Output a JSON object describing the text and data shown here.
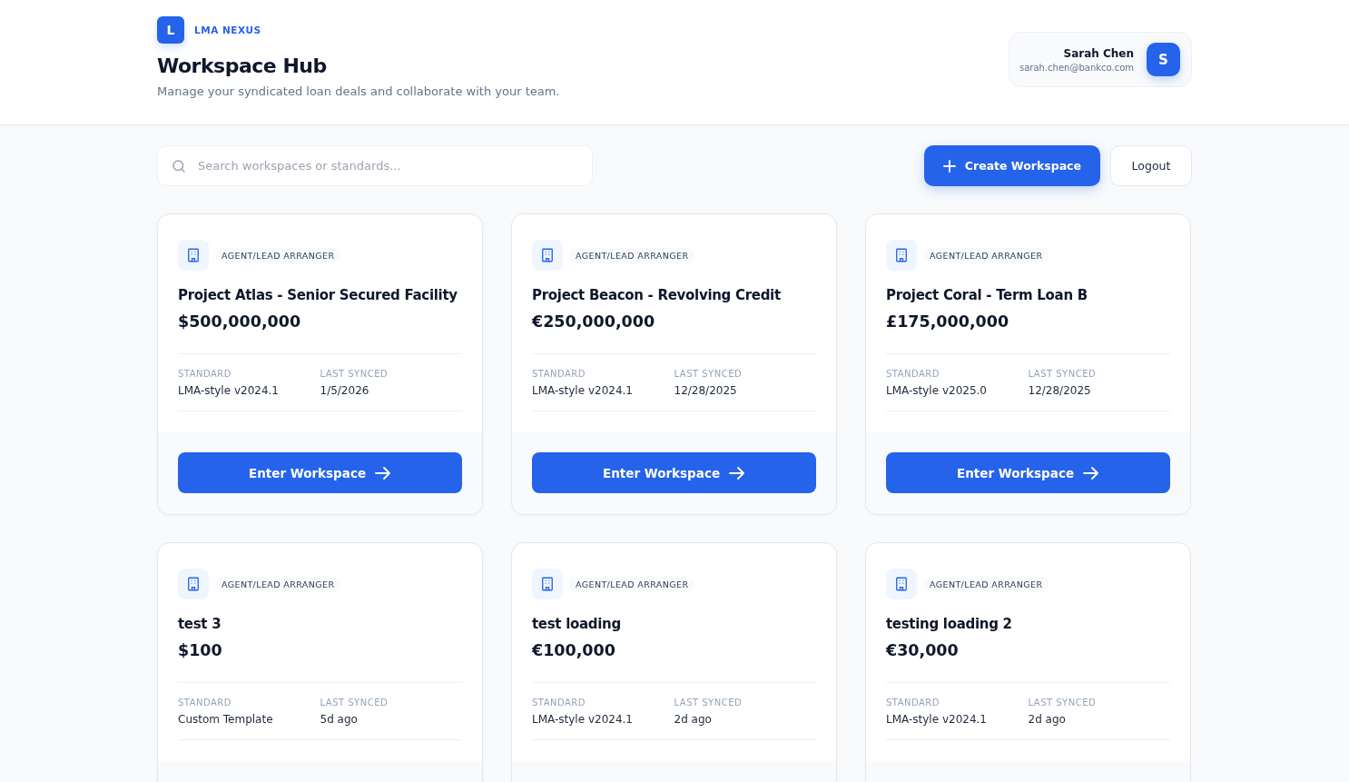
{
  "brand": {
    "logo_letter": "L",
    "name": "LMA NEXUS"
  },
  "header": {
    "title": "Workspace Hub",
    "subtitle": "Manage your syndicated loan deals and collaborate with your team."
  },
  "user": {
    "name": "Sarah Chen",
    "email": "sarah.chen@bankco.com",
    "avatar_letter": "S"
  },
  "search": {
    "placeholder": "Search workspaces or standards..."
  },
  "actions": {
    "create": "Create Workspace",
    "logout": "Logout"
  },
  "workspaces": [
    {
      "role": "AGENT/LEAD ARRANGER",
      "title": "Project Atlas - Senior Secured Facility",
      "amount": "$500,000,000",
      "standard_label": "STANDARD",
      "standard": "LMA-style v2024.1",
      "synced_label": "LAST SYNCED",
      "synced": "1/5/2026",
      "button": "Enter Workspace"
    },
    {
      "role": "AGENT/LEAD ARRANGER",
      "title": "Project Beacon - Revolving Credit",
      "amount": "€250,000,000",
      "standard_label": "STANDARD",
      "standard": "LMA-style v2024.1",
      "synced_label": "LAST SYNCED",
      "synced": "12/28/2025",
      "button": "Enter Workspace"
    },
    {
      "role": "AGENT/LEAD ARRANGER",
      "title": "Project Coral - Term Loan B",
      "amount": "£175,000,000",
      "standard_label": "STANDARD",
      "standard": "LMA-style v2025.0",
      "synced_label": "LAST SYNCED",
      "synced": "12/28/2025",
      "button": "Enter Workspace"
    },
    {
      "role": "AGENT/LEAD ARRANGER",
      "title": "test 3",
      "amount": "$100",
      "standard_label": "STANDARD",
      "standard": "Custom Template",
      "synced_label": "LAST SYNCED",
      "synced": "5d ago"
    },
    {
      "role": "AGENT/LEAD ARRANGER",
      "title": "test loading",
      "amount": "€100,000",
      "standard_label": "STANDARD",
      "standard": "LMA-style v2024.1",
      "synced_label": "LAST SYNCED",
      "synced": "2d ago"
    },
    {
      "role": "AGENT/LEAD ARRANGER",
      "title": "testing loading 2",
      "amount": "€30,000",
      "standard_label": "STANDARD",
      "standard": "LMA-style v2024.1",
      "synced_label": "LAST SYNCED",
      "synced": "2d ago"
    }
  ]
}
